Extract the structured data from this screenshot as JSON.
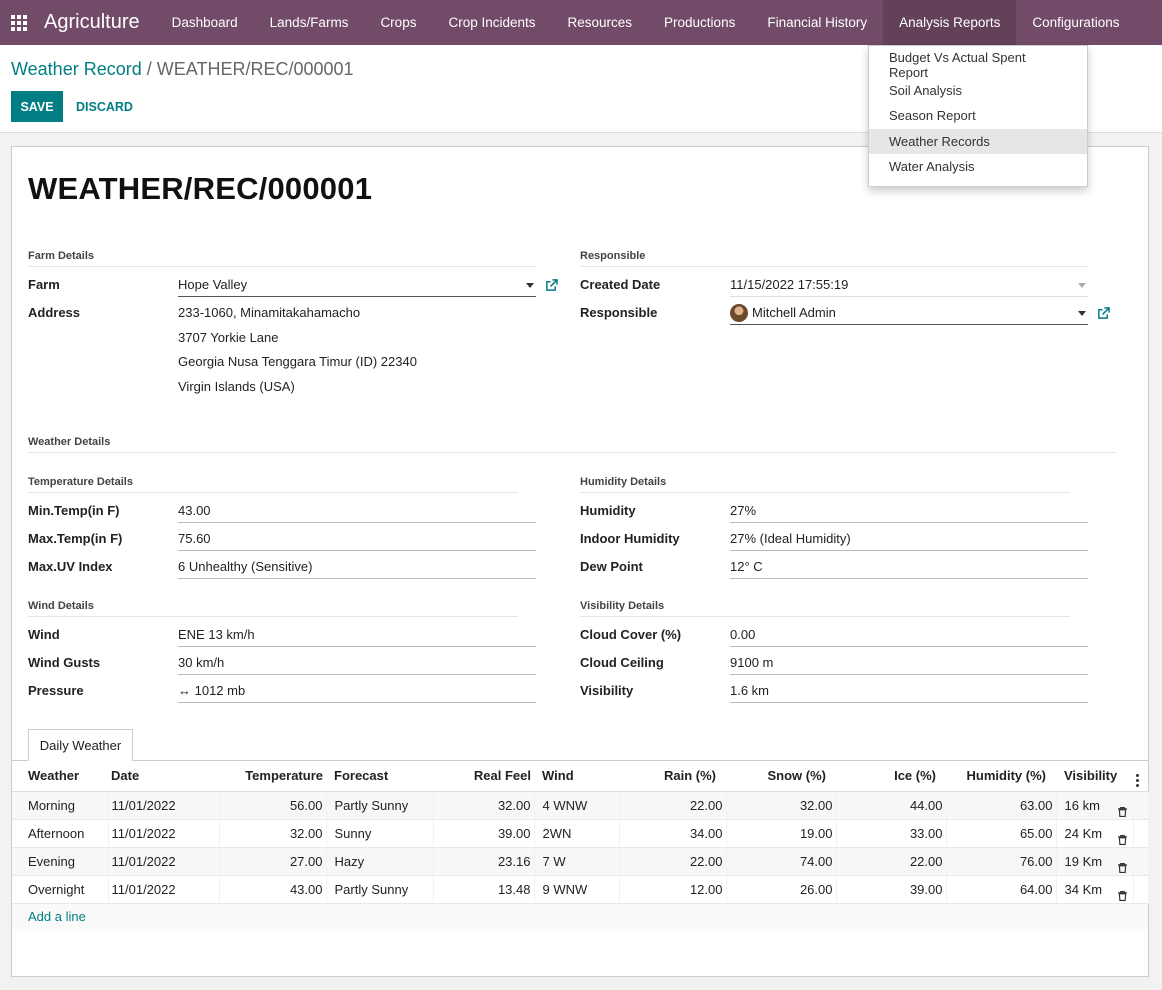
{
  "app": {
    "name": "Agriculture"
  },
  "menu": [
    "Dashboard",
    "Lands/Farms",
    "Crops",
    "Crop Incidents",
    "Resources",
    "Productions",
    "Financial History",
    "Analysis Reports",
    "Configurations"
  ],
  "dropdown": [
    "Budget Vs Actual Spent Report",
    "Soil Analysis",
    "Season Report",
    "Weather Records",
    "Water Analysis"
  ],
  "breadcrumb": {
    "parent": "Weather Record",
    "sep": "/",
    "current": "WEATHER/REC/000001"
  },
  "buttons": {
    "save": "SAVE",
    "discard": "DISCARD"
  },
  "record": {
    "title": "WEATHER/REC/000001"
  },
  "farm_details": {
    "section": "Farm Details",
    "farm_label": "Farm",
    "farm_value": "Hope Valley",
    "address_label": "Address",
    "address_lines": [
      "233-1060, Minamitakahamacho",
      "3707 Yorkie Lane",
      "Georgia  Nusa Tenggara Timur (ID)  22340",
      "Virgin Islands (USA)"
    ]
  },
  "responsible_section": {
    "section": "Responsible",
    "created_label": "Created Date",
    "created_value": "11/15/2022 17:55:19",
    "responsible_label": "Responsible",
    "responsible_value": "Mitchell Admin"
  },
  "weather_details": {
    "section": "Weather Details"
  },
  "temperature": {
    "section": "Temperature Details",
    "fields": [
      {
        "label": "Min.Temp(in F)",
        "value": "43.00"
      },
      {
        "label": "Max.Temp(in F)",
        "value": "75.60"
      },
      {
        "label": "Max.UV Index",
        "value": "6 Unhealthy (Sensitive)"
      }
    ]
  },
  "humidity": {
    "section": "Humidity Details",
    "fields": [
      {
        "label": "Humidity",
        "value": "27%"
      },
      {
        "label": "Indoor Humidity",
        "value": "27% (Ideal Humidity)"
      },
      {
        "label": "Dew Point",
        "value": "12° C"
      }
    ]
  },
  "wind": {
    "section": "Wind Details",
    "fields": [
      {
        "label": "Wind",
        "value": "ENE 13 km/h"
      },
      {
        "label": "Wind Gusts",
        "value": "30 km/h"
      },
      {
        "label": "Pressure",
        "value": "↔ 1012 mb"
      }
    ]
  },
  "visibility": {
    "section": "Visibility Details",
    "fields": [
      {
        "label": "Cloud Cover (%)",
        "value": "0.00"
      },
      {
        "label": "Cloud Ceiling",
        "value": "9100 m"
      },
      {
        "label": "Visibility",
        "value": "1.6 km"
      }
    ]
  },
  "tab": {
    "label": "Daily Weather"
  },
  "table": {
    "headers": [
      "Weather",
      "Date",
      "Temperature",
      "Forecast",
      "Real Feel",
      "Wind",
      "Rain (%)",
      "Snow (%)",
      "Ice (%)",
      "Humidity (%)",
      "Visibility"
    ],
    "rows": [
      [
        "Morning",
        "11/01/2022",
        "56.00",
        "Partly Sunny",
        "32.00",
        "4 WNW",
        "22.00",
        "32.00",
        "44.00",
        "63.00",
        "16 km"
      ],
      [
        "Afternoon",
        "11/01/2022",
        "32.00",
        "Sunny",
        "39.00",
        "2WN",
        "34.00",
        "19.00",
        "33.00",
        "65.00",
        "24 Km"
      ],
      [
        "Evening",
        "11/01/2022",
        "27.00",
        "Hazy",
        "23.16",
        "7 W",
        "22.00",
        "74.00",
        "22.00",
        "76.00",
        "19 Km"
      ],
      [
        "Overnight",
        "11/01/2022",
        "43.00",
        "Partly Sunny",
        "13.48",
        "9 WNW",
        "12.00",
        "26.00",
        "39.00",
        "64.00",
        "34 Km"
      ]
    ],
    "add_line": "Add a line"
  },
  "colors": {
    "navbar": "#714b67",
    "accent": "#017e84"
  }
}
